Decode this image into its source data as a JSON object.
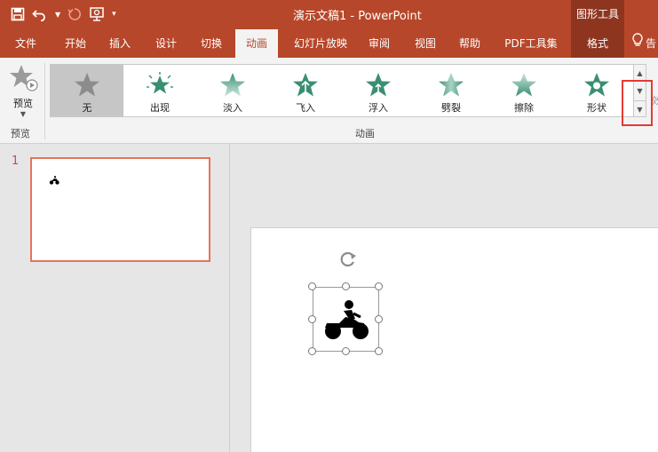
{
  "app": {
    "doc_title": "演示文稿1  -  PowerPoint",
    "context_tool_label": "图形工具"
  },
  "quick_access": {
    "save_icon": "save-icon",
    "undo_icon": "undo-icon",
    "redo_icon": "redo-icon",
    "present_icon": "present-from-start-icon",
    "customize_icon": "customize-qat-icon"
  },
  "tabs": [
    {
      "label": "文件"
    },
    {
      "label": "开始"
    },
    {
      "label": "插入"
    },
    {
      "label": "设计"
    },
    {
      "label": "切换"
    },
    {
      "label": "动画"
    },
    {
      "label": "幻灯片放映"
    },
    {
      "label": "审阅"
    },
    {
      "label": "视图"
    },
    {
      "label": "帮助"
    },
    {
      "label": "PDF工具集"
    },
    {
      "label": "格式"
    },
    {
      "label": "告"
    }
  ],
  "ribbon": {
    "preview": {
      "label": "预览",
      "group_label": "预览"
    },
    "animation_group_label": "动画",
    "gallery": [
      {
        "label": "无",
        "icon": "none-star-icon"
      },
      {
        "label": "出现",
        "icon": "appear-star-icon"
      },
      {
        "label": "淡入",
        "icon": "fade-star-icon"
      },
      {
        "label": "飞入",
        "icon": "fly-in-star-icon"
      },
      {
        "label": "浮入",
        "icon": "float-in-star-icon"
      },
      {
        "label": "劈裂",
        "icon": "split-star-icon"
      },
      {
        "label": "擦除",
        "icon": "wipe-star-icon"
      },
      {
        "label": "形状",
        "icon": "shape-star-icon"
      }
    ],
    "effect_options_partial": "效"
  },
  "slides_pane": {
    "slide_number": "1"
  },
  "colors": {
    "brand": "#b7472a",
    "context_tab": "#8e3520",
    "highlight": "#e53935",
    "star_green": "#3a8f73"
  }
}
